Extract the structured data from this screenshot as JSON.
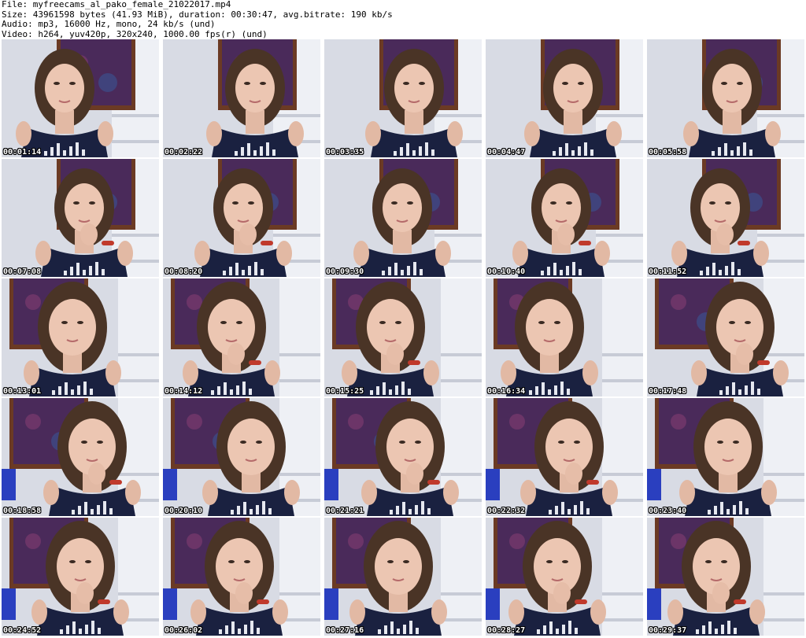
{
  "header": {
    "file_line": "File: myfreecams_al_pako_female_21022017.mp4",
    "size_line": "Size: 43961598 bytes (41.93 MiB), duration: 00:30:47, avg.bitrate: 190 kb/s",
    "audio_line": "Audio: mp3, 16000 Hz, mono, 24 kb/s (und)",
    "video_line": "Video: h264, yuv420p, 320x240, 1000.00 fps(r) (und)"
  },
  "thumbnails": [
    {
      "timestamp": "00:01:14"
    },
    {
      "timestamp": "00:02:22"
    },
    {
      "timestamp": "00:03:35"
    },
    {
      "timestamp": "00:04:47"
    },
    {
      "timestamp": "00:05:58"
    },
    {
      "timestamp": "00:07:08"
    },
    {
      "timestamp": "00:08:20"
    },
    {
      "timestamp": "00:09:30"
    },
    {
      "timestamp": "00:10:40"
    },
    {
      "timestamp": "00:11:52"
    },
    {
      "timestamp": "00:13:01"
    },
    {
      "timestamp": "00:14:12"
    },
    {
      "timestamp": "00:15:25"
    },
    {
      "timestamp": "00:16:34"
    },
    {
      "timestamp": "00:17:48"
    },
    {
      "timestamp": "00:18:58"
    },
    {
      "timestamp": "00:20:10"
    },
    {
      "timestamp": "00:21:21"
    },
    {
      "timestamp": "00:22:32"
    },
    {
      "timestamp": "00:23:40"
    },
    {
      "timestamp": "00:24:52"
    },
    {
      "timestamp": "00:26:02"
    },
    {
      "timestamp": "00:27:16"
    },
    {
      "timestamp": "00:28:27"
    },
    {
      "timestamp": "00:29:37"
    }
  ],
  "colors": {
    "background": "#ffffff",
    "header_text": "#000000",
    "timestamp_text": "#ffffff",
    "timestamp_outline": "#000000"
  }
}
